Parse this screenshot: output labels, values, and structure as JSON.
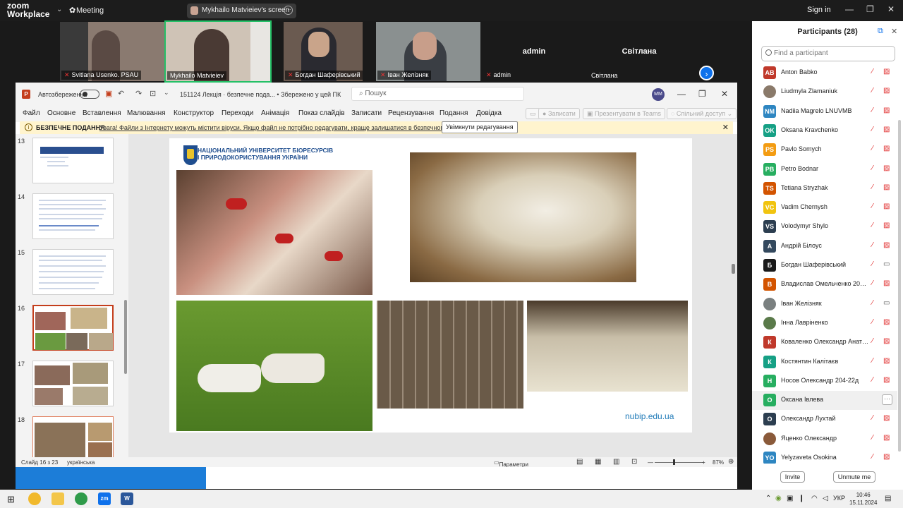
{
  "zoom": {
    "brand_line1": "zoom",
    "brand_line2": "Workplace",
    "meeting_label": "Meeting",
    "share_label": "Mykhailo Matvieiev's screen",
    "signin": "Sign in"
  },
  "videos": [
    {
      "name": "Svitlana Usenko. PSAU",
      "kind": "photo",
      "color": "#8a7a70"
    },
    {
      "name": "Mykhailo Matvieiev",
      "kind": "photo",
      "color": "#b8a89a"
    },
    {
      "name": "Богдан Шаферівський",
      "kind": "photo",
      "color": "#6a5a50"
    },
    {
      "name": "Іван Желізняк",
      "kind": "photo",
      "color": "#7a8080"
    },
    {
      "name": "admin",
      "kind": "name"
    },
    {
      "name": "Світлана",
      "kind": "name"
    }
  ],
  "ppt": {
    "autosave": "Автозбереження",
    "doc_title": "151124 Лекція · безпечне пода... • Збережено у цей ПК",
    "search_placeholder": "Пошук",
    "user_initials": "ММ",
    "menu": [
      "Файл",
      "Основне",
      "Вставлення",
      "Малювання",
      "Конструктор",
      "Переходи",
      "Анімація",
      "Показ слайдів",
      "Записати",
      "Рецензування",
      "Подання",
      "Довідка"
    ],
    "record_btn": "Записати",
    "teams_btn": "Презентувати в Teams",
    "share_btn": "Спільний доступ",
    "warning_title": "БЕЗПЕЧНЕ ПОДАННЯ",
    "warning_msg": "Увага! Файли з Інтернету можуть містити віруси. Якщо файл не потрібно редагувати, краще залишатися в безпечному поданні.",
    "warning_button": "Увімкнути редагування",
    "thumbnails": [
      {
        "num": "13"
      },
      {
        "num": "14"
      },
      {
        "num": "15"
      },
      {
        "num": "16"
      },
      {
        "num": "17"
      },
      {
        "num": "18"
      }
    ],
    "slide": {
      "university_line1": "НАЦІОНАЛЬНИЙ УНІВЕРСИТЕТ БІОРЕСУРСІВ",
      "university_line2": "І ПРИРОДОКОРИСТУВАННЯ УКРАЇНИ",
      "url": "nubip.edu.ua"
    },
    "status_slide": "Слайд 16 з 23",
    "status_lang": "українська",
    "status_view": "Параметри відображення",
    "zoom_level": "87%"
  },
  "panel": {
    "title": "Participants (28)",
    "find_placeholder": "Find a participant",
    "participants": [
      {
        "initials": "AB",
        "name": "Anton Babko",
        "color": "#c0392b",
        "cam": "off"
      },
      {
        "initials": "",
        "name": "Liudmyla Zlamaniuk",
        "color": "#8a7a6a",
        "cam": "off"
      },
      {
        "initials": "NM",
        "name": "Nadiia Magrelo LNUVMB",
        "color": "#2e86c1",
        "cam": "off"
      },
      {
        "initials": "OK",
        "name": "Oksana Kravchenko",
        "color": "#16a085",
        "cam": "off"
      },
      {
        "initials": "PS",
        "name": "Pavlo Somych",
        "color": "#f39c12",
        "cam": "off"
      },
      {
        "initials": "PB",
        "name": "Petro Bodnar",
        "color": "#27ae60",
        "cam": "off"
      },
      {
        "initials": "TS",
        "name": "Tetiana Stryzhak",
        "color": "#d35400",
        "cam": "off"
      },
      {
        "initials": "VC",
        "name": "Vadim Chernysh",
        "color": "#f1c40f",
        "cam": "off"
      },
      {
        "initials": "VS",
        "name": "Volodymyr Shylo",
        "color": "#2c3e50",
        "cam": "off"
      },
      {
        "initials": "А",
        "name": "Андрій Білоус",
        "color": "#34495e",
        "cam": "off"
      },
      {
        "initials": "Б",
        "name": "Богдан Шаферівський",
        "color": "#1a1a1a",
        "cam": "on"
      },
      {
        "initials": "В",
        "name": "Владислав Омельченко 204-2...",
        "color": "#d35400",
        "cam": "off"
      },
      {
        "initials": "",
        "name": "Іван Желізняк",
        "color": "#7a8080",
        "cam": "on"
      },
      {
        "initials": "",
        "name": "Інна Лавріненко",
        "color": "#5a7a4a",
        "cam": "off"
      },
      {
        "initials": "К",
        "name": "Коваленко Олександр Анатол...",
        "color": "#c0392b",
        "cam": "off"
      },
      {
        "initials": "К",
        "name": "Костянтин Калітаєв",
        "color": "#16a085",
        "cam": "off"
      },
      {
        "initials": "Н",
        "name": "Носов Олександр 204-22д",
        "color": "#27ae60",
        "cam": "off"
      },
      {
        "initials": "О",
        "name": "Оксана Івлева",
        "color": "#27ae60",
        "cam": "more"
      },
      {
        "initials": "О",
        "name": "Олександр Лухтай",
        "color": "#2c3e50",
        "cam": "off"
      },
      {
        "initials": "",
        "name": "Яценко Олександр",
        "color": "#8a5a3a",
        "cam": "off"
      },
      {
        "initials": "YO",
        "name": "Yelyzaveta Osokina",
        "color": "#2e86c1",
        "cam": "off"
      }
    ],
    "invite": "Invite",
    "unmute": "Unmute me"
  },
  "taskbar": {
    "lang": "УКР",
    "time": "10:46",
    "date": "15.11.2024"
  }
}
